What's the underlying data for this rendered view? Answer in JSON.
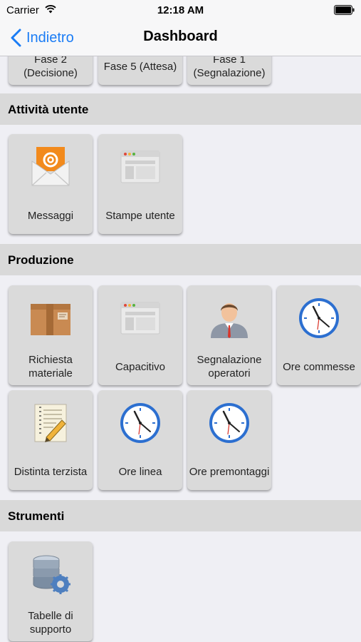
{
  "status_bar": {
    "carrier": "Carrier",
    "time": "12:18 AM"
  },
  "nav": {
    "back_label": "Indietro",
    "title": "Dashboard"
  },
  "top_row": [
    {
      "label": "Fase 2\n(Decisione)"
    },
    {
      "label": "Fase 5 (Attesa)"
    },
    {
      "label": "Fase 1\n(Segnalazione)"
    }
  ],
  "sections": {
    "attivita": {
      "title": "Attività utente",
      "items": [
        {
          "label": "Messaggi",
          "icon": "mail-icon"
        },
        {
          "label": "Stampe utente",
          "icon": "window-icon"
        }
      ]
    },
    "produzione": {
      "title": "Produzione",
      "items": [
        {
          "label": "Richiesta materiale",
          "icon": "package-icon"
        },
        {
          "label": "Capacitivo",
          "icon": "window-icon"
        },
        {
          "label": "Segnalazione operatori",
          "icon": "operator-icon"
        },
        {
          "label": "Ore commesse",
          "icon": "clock-icon"
        },
        {
          "label": "Distinta terzista",
          "icon": "document-pencil-icon"
        },
        {
          "label": "Ore linea",
          "icon": "clock-icon"
        },
        {
          "label": "Ore premontaggi",
          "icon": "clock-icon"
        }
      ]
    },
    "strumenti": {
      "title": "Strumenti",
      "items": [
        {
          "label": "Tabelle di supporto",
          "icon": "database-gear-icon"
        }
      ]
    }
  },
  "colors": {
    "accent": "#1a7cf5",
    "section_bg": "#d9d9d9",
    "tile_bg": "#dadada",
    "page_bg": "#efeff4"
  }
}
